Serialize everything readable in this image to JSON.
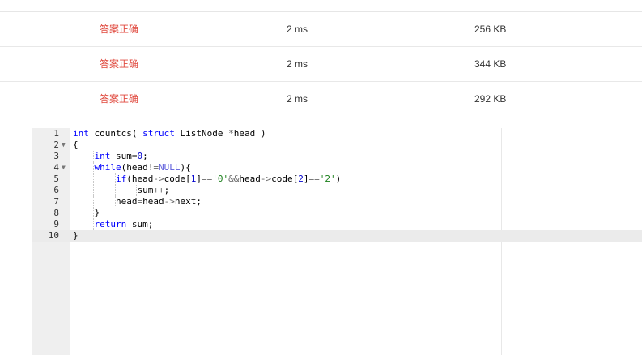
{
  "results": [
    {
      "status": "答案正确",
      "time": "2 ms",
      "memory": "256 KB"
    },
    {
      "status": "答案正确",
      "time": "2 ms",
      "memory": "344 KB"
    },
    {
      "status": "答案正确",
      "time": "2 ms",
      "memory": "292 KB"
    }
  ],
  "editor": {
    "line_numbers": [
      "1",
      "2",
      "3",
      "4",
      "5",
      "6",
      "7",
      "8",
      "9",
      "10"
    ],
    "code_lines": [
      "int countcs( struct ListNode *head )",
      "{",
      "    int sum=0;",
      "    while(head!=NULL){",
      "        if(head->code[1]=='0'&&head->code[2]=='2')",
      "            sum++;",
      "        head=head->next;",
      "    }",
      "    return sum;",
      "}"
    ],
    "fold_marker_icon": "triangle-down-icon",
    "folded_lines": [
      "2",
      "4"
    ],
    "active_line": "10"
  }
}
